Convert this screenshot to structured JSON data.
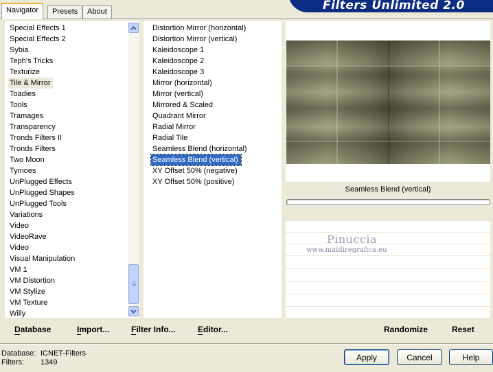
{
  "app_title": "Filters Unlimited 2.0",
  "tabs": [
    "Navigator",
    "Presets",
    "About"
  ],
  "categories": [
    "Special Effects 1",
    "Special Effects 2",
    "Sybia",
    "Teph's Tricks",
    "Texturize",
    "Tile & Mirror",
    "Toadies",
    "Tools",
    "Tramages",
    "Transparency",
    "Tronds Filters II",
    "Tronds Filters",
    "Two Moon",
    "Tymoes",
    "UnPlugged Effects",
    "UnPlugged Shapes",
    "UnPlugged Tools",
    "Variations",
    "Video",
    "VideoRave",
    "Video",
    "Visual Manipulation",
    "VM 1",
    "VM Distortion",
    "VM Stylize",
    "VM Texture",
    "Willy"
  ],
  "selected_category": "Tile & Mirror",
  "filters": [
    "Distortion Mirror (horizontal)",
    "Distortion Mirror (vertical)",
    "Kaleidoscope 1",
    "Kaleidoscope 2",
    "Kaleidoscope 3",
    "Mirror (horizontal)",
    "Mirror (vertical)",
    "Mirrored & Scaled",
    "Quadrant Mirror",
    "Radial Mirror",
    "Radial Tile",
    "Seamless Blend (horizontal)",
    "Seamless Blend (vertical)",
    "XY Offset 50% (negative)",
    "XY Offset 50% (positive)"
  ],
  "selected_filter": "Seamless Blend (vertical)",
  "preview_label": "Seamless Blend (vertical)",
  "watermark": {
    "name": "Pinuccia",
    "site": "www.maidiregrafica.eu"
  },
  "actions_left": [
    "Database",
    "Import...",
    "Filter Info...",
    "Editor..."
  ],
  "actions_right": [
    "Randomize",
    "Reset"
  ],
  "status": {
    "database_label": "Database:",
    "database_value": "ICNET-Filters",
    "filters_label": "Filters:",
    "filters_value": "1349"
  },
  "buttons": {
    "apply": "Apply",
    "cancel": "Cancel",
    "help": "Help"
  },
  "colors": {
    "selection_blue": "#316ac5",
    "banner_navy": "#0c2c84",
    "tab_accent": "#f3b43a"
  }
}
